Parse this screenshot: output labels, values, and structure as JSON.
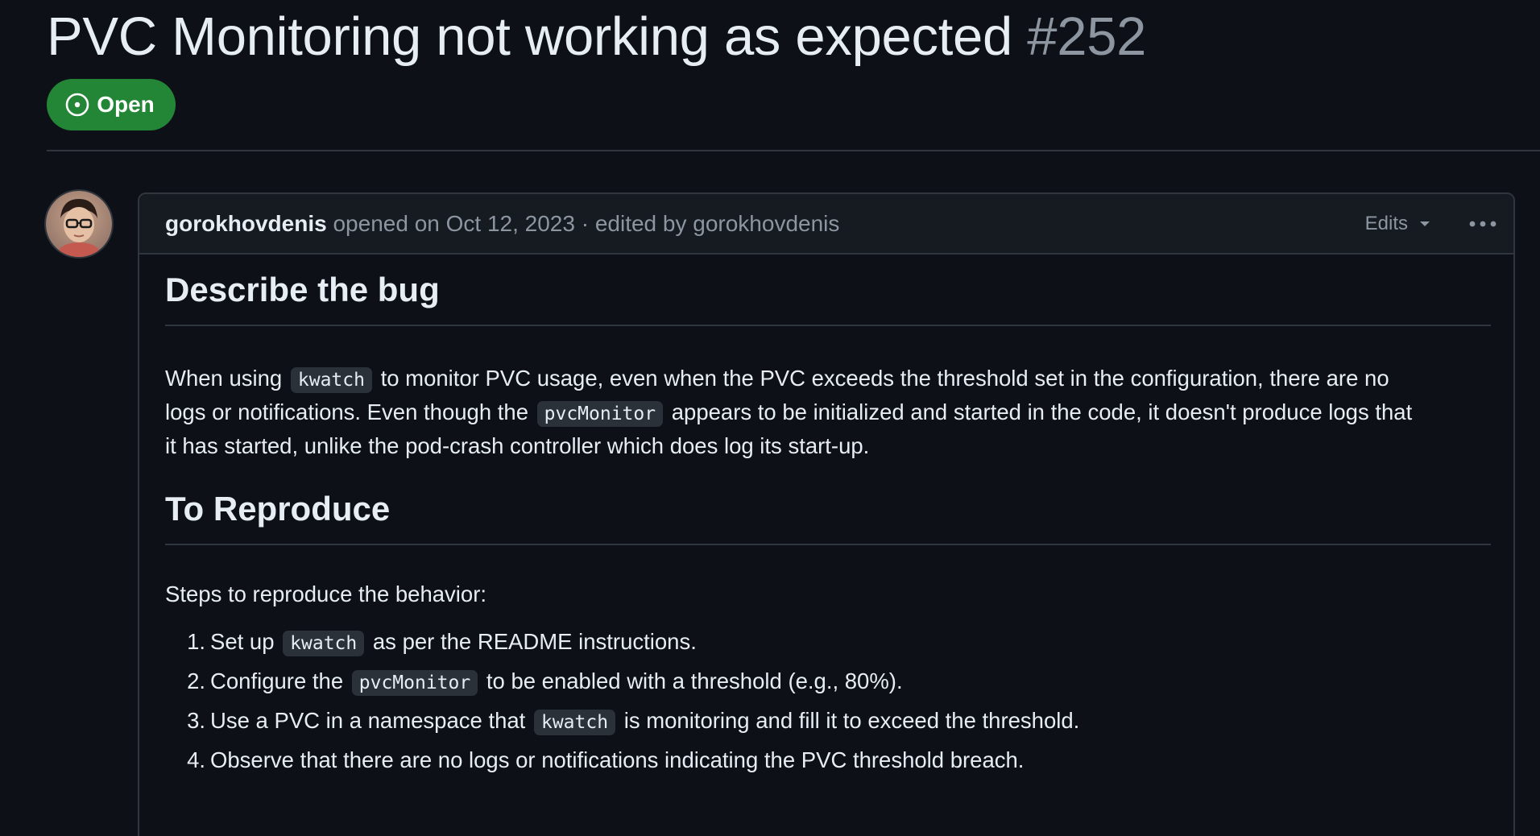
{
  "issue": {
    "title": "PVC Monitoring not working as expected",
    "number": "#252",
    "state": "Open",
    "state_color": "#238636"
  },
  "comment": {
    "author": "gorokhovdenis",
    "opened_text": "opened on Oct 12, 2023 · edited by gorokhovdenis",
    "edits_label": "Edits"
  },
  "body": {
    "heading_bug": "Describe the bug",
    "bug_p": {
      "l1_a": "When using",
      "l1_code": "kwatch",
      "l1_b": "to monitor PVC usage, even when the PVC exceeds the threshold set in the configuration, there are no",
      "l2_a": "logs or notifications. Even though the",
      "l2_code": "pvcMonitor",
      "l2_b": "appears to be initialized and started in the code, it doesn't produce logs that",
      "l3": "it has started, unlike the pod-crash controller which does log its start-up."
    },
    "heading_repro": "To Reproduce",
    "steps_intro": "Steps to reproduce the behavior:",
    "steps": [
      {
        "num": "1.",
        "a": "Set up",
        "code": "kwatch",
        "b": "as per the README instructions."
      },
      {
        "num": "2.",
        "a": "Configure the",
        "code": "pvcMonitor",
        "b": "to be enabled with a threshold (e.g., 80%)."
      },
      {
        "num": "3.",
        "a": "Use a PVC in a namespace that",
        "code": "kwatch",
        "b": "is monitoring and fill it to exceed the threshold."
      },
      {
        "num": "4.",
        "a": "Observe that there are no logs or notifications indicating the PVC threshold breach.",
        "code": "",
        "b": ""
      }
    ]
  }
}
